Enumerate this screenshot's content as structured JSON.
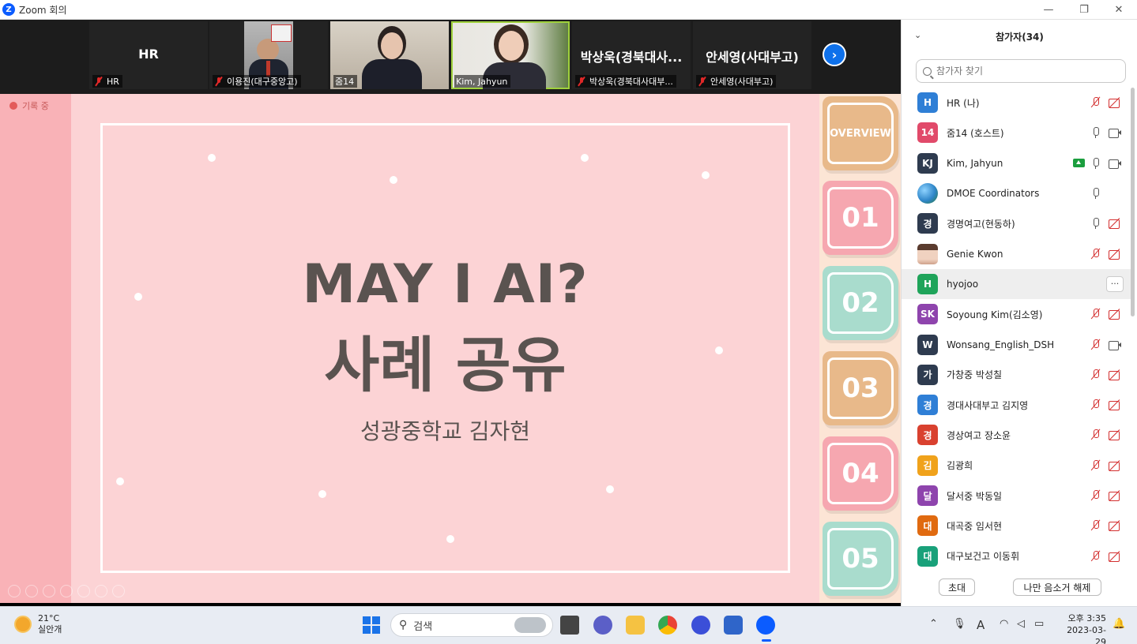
{
  "window": {
    "title": "Zoom 회의"
  },
  "gallery": {
    "tiles": [
      {
        "id": "hr",
        "big_name": "HR",
        "caption": "HR",
        "muted": true
      },
      {
        "id": "lee",
        "big_name": "",
        "caption": "이용진(대구중앙고)",
        "muted": true
      },
      {
        "id": "zoom14",
        "big_name": "",
        "caption": "줌14",
        "muted": false
      },
      {
        "id": "kim",
        "big_name": "",
        "caption": "Kim, Jahyun",
        "muted": false
      },
      {
        "id": "park",
        "big_name": "박상욱(경북대사...",
        "caption": "박상욱(경북대사대부...",
        "muted": true
      },
      {
        "id": "ahn",
        "big_name": "안세영(사대부고)",
        "caption": "안세영(사대부고)",
        "muted": true
      }
    ]
  },
  "share": {
    "recording_label": "기록 중",
    "title_line1": "MAY I AI?",
    "title_line2": "사례 공유",
    "subtitle": "성광중학교 김자현",
    "tabs": [
      "OVERVIEW",
      "01",
      "02",
      "03",
      "04",
      "05"
    ]
  },
  "panel": {
    "header": "참가자(34)",
    "search_placeholder": "참가자 찾기",
    "participants": [
      {
        "initials": "H",
        "name": "HR (나)",
        "avatar_color": "#2f7fd6",
        "mic": "off",
        "cam": "off"
      },
      {
        "initials": "14",
        "name": "줌14 (호스트)",
        "avatar_color": "#e14a6a",
        "mic": "on",
        "cam": "on"
      },
      {
        "initials": "KJ",
        "name": "Kim, Jahyun",
        "avatar_color": "#2e3b4f",
        "mic": "on",
        "cam": "on",
        "sharing": true
      },
      {
        "initials": "",
        "name": "DMOE Coordinators",
        "avatar_color": "#3a8fd0",
        "mic": "on",
        "cam": "none",
        "globe": true
      },
      {
        "initials": "경",
        "name": "경명여고(현동하)",
        "avatar_color": "#2e3b4f",
        "mic": "on",
        "cam": "off"
      },
      {
        "initials": "",
        "name": "Genie Kwon",
        "avatar_color": "#c9a48e",
        "mic": "off",
        "cam": "off",
        "photo": true
      },
      {
        "initials": "H",
        "name": "hyojoo",
        "avatar_color": "#1fa45a",
        "mic": "none",
        "cam": "none",
        "hover": true
      },
      {
        "initials": "SK",
        "name": "Soyoung Kim(김소영)",
        "avatar_color": "#8e44ad",
        "mic": "off",
        "cam": "off"
      },
      {
        "initials": "W",
        "name": "Wonsang_English_DSH",
        "avatar_color": "#2e3b4f",
        "mic": "off",
        "cam": "on"
      },
      {
        "initials": "가",
        "name": "가창중 박성칠",
        "avatar_color": "#2e3b4f",
        "mic": "off",
        "cam": "off"
      },
      {
        "initials": "경",
        "name": "경대사대부고 김지영",
        "avatar_color": "#2f7fd6",
        "mic": "off",
        "cam": "off"
      },
      {
        "initials": "경",
        "name": "경상여고 장소윤",
        "avatar_color": "#d9412f",
        "mic": "off",
        "cam": "off"
      },
      {
        "initials": "김",
        "name": "김광희",
        "avatar_color": "#f0a21b",
        "mic": "off",
        "cam": "off"
      },
      {
        "initials": "달",
        "name": "달서중 박동일",
        "avatar_color": "#8e44ad",
        "mic": "off",
        "cam": "off"
      },
      {
        "initials": "대",
        "name": "대곡중 임서현",
        "avatar_color": "#e06a10",
        "mic": "off",
        "cam": "off"
      },
      {
        "initials": "대",
        "name": "대구보건고 이동휘",
        "avatar_color": "#19a17a",
        "mic": "off",
        "cam": "off"
      }
    ],
    "invite_label": "초대",
    "unmute_label": "나만 음소거 해제",
    "more_label": "···"
  },
  "taskbar": {
    "temperature": "21°C",
    "weather_desc": "실안개",
    "search_label": "검색",
    "time": "오후 3:35",
    "date": "2023-03-29",
    "lang_indicator": "A"
  }
}
